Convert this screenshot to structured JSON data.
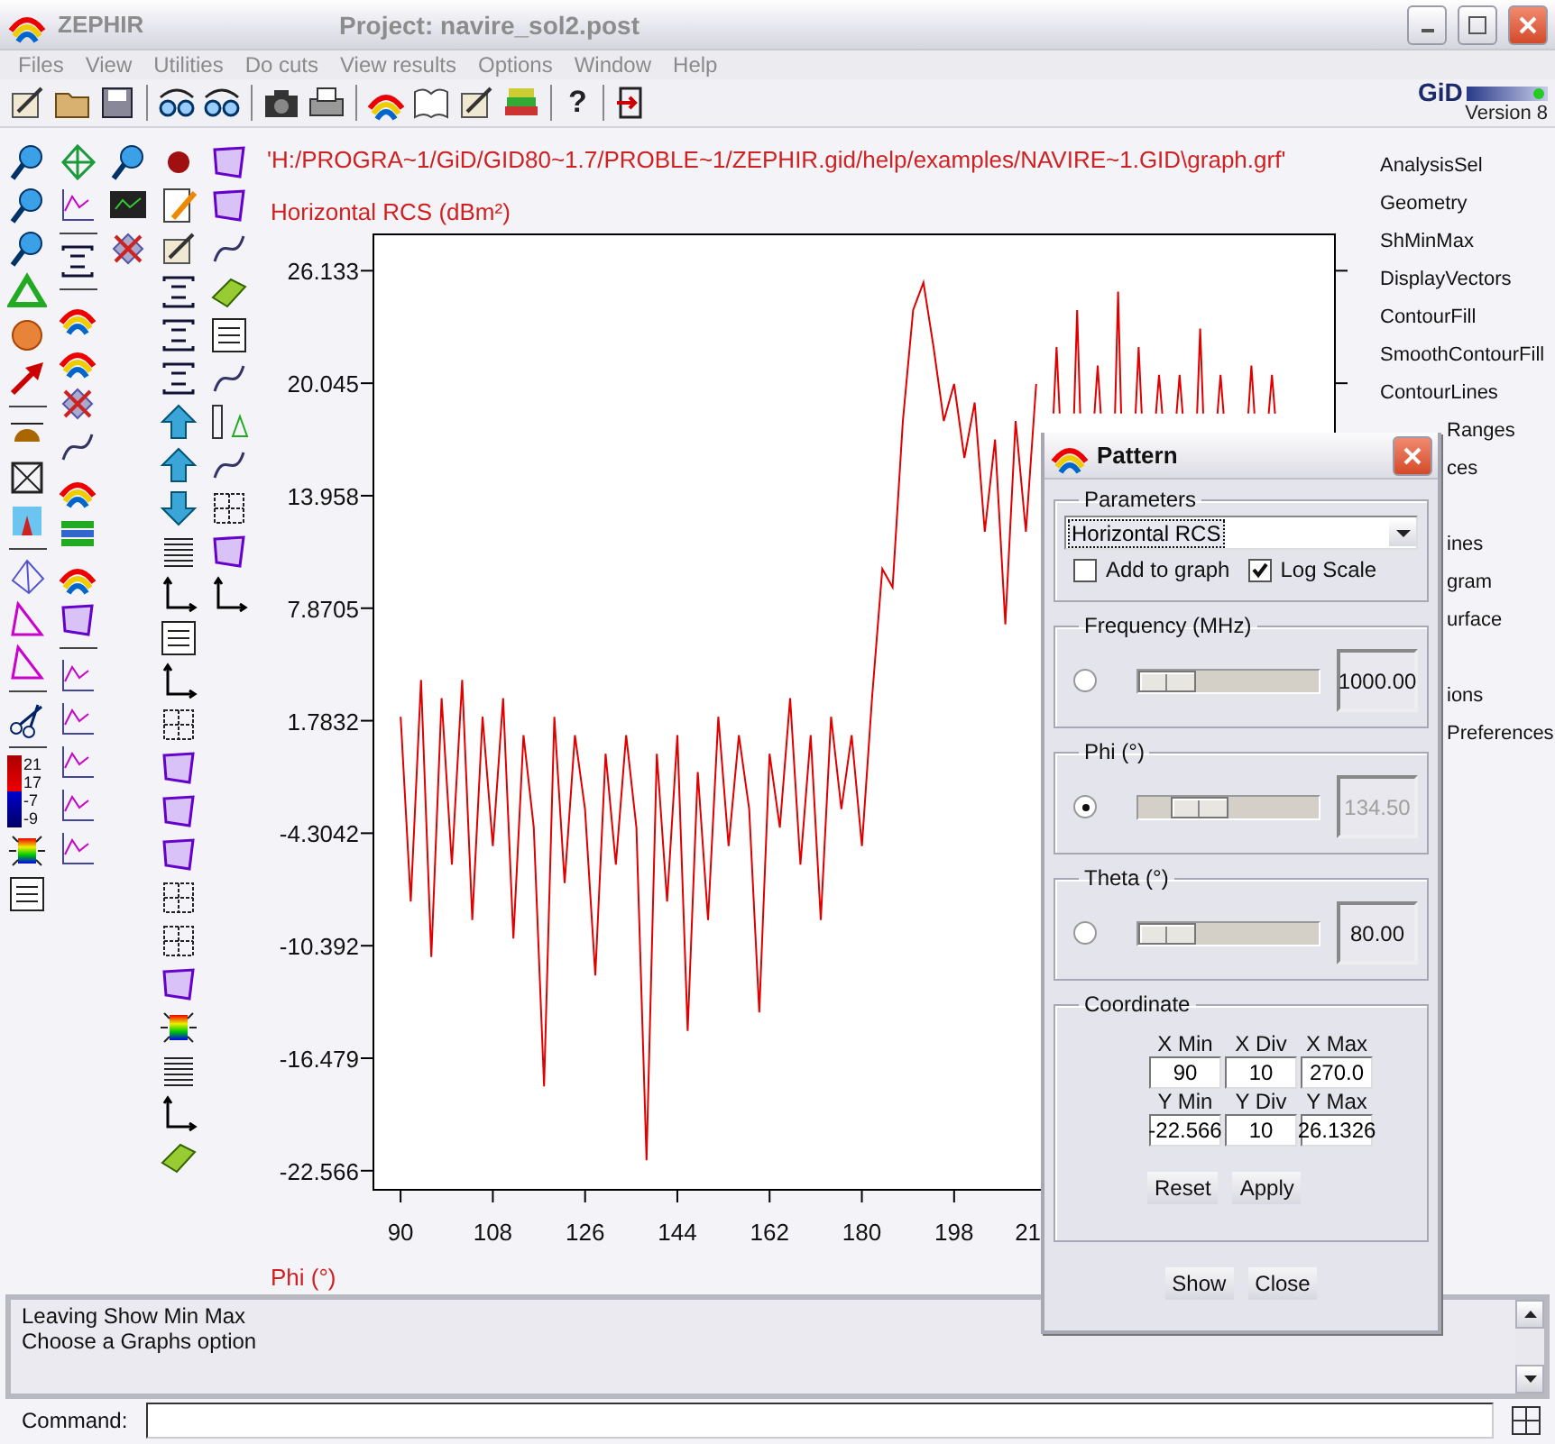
{
  "window": {
    "app_name": "ZEPHIR",
    "title": "Project: navire_sol2.post"
  },
  "menu": [
    "Files",
    "View",
    "Utilities",
    "Do cuts",
    "View results",
    "Options",
    "Window",
    "Help"
  ],
  "toolbar": {
    "help_glyph": "?"
  },
  "logo": {
    "brand": "GiD",
    "version": "Version 8"
  },
  "left_toolbar": {
    "color_scale": [
      "21",
      "17",
      "-7",
      "-9"
    ]
  },
  "graph": {
    "covered_tick_label": "21",
    "file_path": "'H:/PROGRA~1/GiD/GID80~1.7/PROBLE~1/ZEPHIR.gid/help/examples/NAVIRE~1.GID\\graph.grf'",
    "chart_data": {
      "type": "line",
      "xlabel": "Phi (°)",
      "ylabel": "Horizontal RCS (dBm²)",
      "x": [
        90,
        92,
        94,
        96,
        98,
        100,
        102,
        104,
        106,
        108,
        110,
        112,
        114,
        116,
        118,
        120,
        122,
        124,
        126,
        128,
        130,
        132,
        134,
        136,
        138,
        140,
        142,
        144,
        146,
        148,
        150,
        152,
        154,
        156,
        158,
        160,
        162,
        164,
        166,
        168,
        170,
        172,
        174,
        176,
        178,
        180,
        182,
        184,
        186,
        188,
        190,
        192,
        194,
        196,
        198,
        200,
        202,
        204,
        206,
        208,
        210,
        212,
        214,
        217.4,
        218,
        218.6,
        221.4,
        222,
        222.6,
        225.4,
        226,
        226.6,
        229.4,
        230,
        230.6,
        233.4,
        234,
        234.6,
        237.4,
        238,
        238.6,
        241.4,
        242,
        242.6,
        245.4,
        246,
        246.6,
        249.4,
        250,
        250.6,
        255.4,
        256,
        256.6,
        259.4,
        260,
        260.6
      ],
      "series": [
        {
          "color": "#e00000",
          "values": [
            2,
            -8,
            4,
            -11,
            3,
            -6,
            4,
            -9,
            2,
            -5,
            3,
            -10,
            1,
            -4,
            -18,
            2,
            -7,
            1,
            -3,
            -12,
            0,
            -6,
            1,
            -4,
            -22,
            0,
            -8,
            1,
            -15,
            -1,
            -9,
            2,
            -5,
            1,
            -3,
            -14,
            0,
            -4,
            3,
            -6,
            1,
            -9,
            2,
            -3,
            1,
            -5,
            3,
            10,
            9,
            18,
            24,
            25.5,
            22,
            18,
            20,
            16,
            19,
            12,
            17,
            7,
            18,
            12,
            20,
            18.4,
            22,
            18.4,
            18.4,
            24,
            18.4,
            18.4,
            21,
            18.4,
            18.4,
            25,
            18.4,
            18.4,
            22,
            18.4,
            18.4,
            20.5,
            18.4,
            18.4,
            20.5,
            18.4,
            18.4,
            23,
            18.4,
            18.4,
            20.5,
            18.4,
            18.4,
            21,
            18.4,
            18.4,
            20.5,
            18.4
          ]
        }
      ],
      "xlim": [
        84.7,
        272.3
      ],
      "ylim": [
        -23.6,
        28.1
      ],
      "xticks": [
        90,
        108,
        126,
        144,
        162,
        180,
        198
      ],
      "yticks": [
        26.133,
        20.045,
        13.958,
        7.8705,
        1.7832,
        -4.3042,
        -10.392,
        -16.479,
        -22.566
      ]
    }
  },
  "sidebar": {
    "items": [
      {
        "label": "AnalysisSel",
        "kind": "full"
      },
      {
        "label": "Geometry",
        "kind": "full"
      },
      {
        "label": "ShMinMax",
        "kind": "full"
      },
      {
        "label": "DisplayVectors",
        "kind": "full"
      },
      {
        "label": "ContourFill",
        "kind": "full"
      },
      {
        "label": "SmoothContourFill",
        "kind": "full"
      },
      {
        "label": "ContourLines",
        "kind": "full"
      },
      {
        "label": "Ranges",
        "kind": "clipped"
      },
      {
        "label": "ces",
        "kind": "clipped"
      },
      {
        "label": "ines",
        "kind": "clippedgap"
      },
      {
        "label": "gram",
        "kind": "clipped"
      },
      {
        "label": "urface",
        "kind": "clipped"
      },
      {
        "label": "ions",
        "kind": "clippedgap"
      },
      {
        "label": "Preferences",
        "kind": "clipped"
      }
    ]
  },
  "messages": [
    "Leaving Show Min Max",
    "Choose a Graphs option"
  ],
  "command": {
    "label": "Command:"
  },
  "dialog": {
    "title": "Pattern",
    "parameters": {
      "legend": "Parameters",
      "selection": "Horizontal RCS",
      "options": [
        {
          "label": "Add to graph",
          "checked": false
        },
        {
          "label": "Log Scale",
          "checked": true
        }
      ]
    },
    "variables": [
      {
        "legend": "Frequency (MHz)",
        "selected": false,
        "level": 0,
        "value": "1000.00",
        "disabled": false
      },
      {
        "legend": "Phi (°)",
        "selected": true,
        "level": 0.26,
        "value": "134.50",
        "disabled": true
      },
      {
        "legend": "Theta (°)",
        "selected": false,
        "level": 0,
        "value": "80.00",
        "disabled": false
      }
    ],
    "coordinate": {
      "legend": "Coordinate",
      "rows": [
        {
          "headers": [
            "X Min",
            "X Div",
            "X Max"
          ],
          "values": [
            "90",
            "10",
            "270.0"
          ]
        },
        {
          "headers": [
            "Y Min",
            "Y Div",
            "Y Max"
          ],
          "values": [
            "-22.566",
            "10",
            "26.1326"
          ]
        }
      ],
      "buttons": [
        "Reset",
        "Apply"
      ]
    },
    "buttons": [
      "Show",
      "Close"
    ]
  }
}
